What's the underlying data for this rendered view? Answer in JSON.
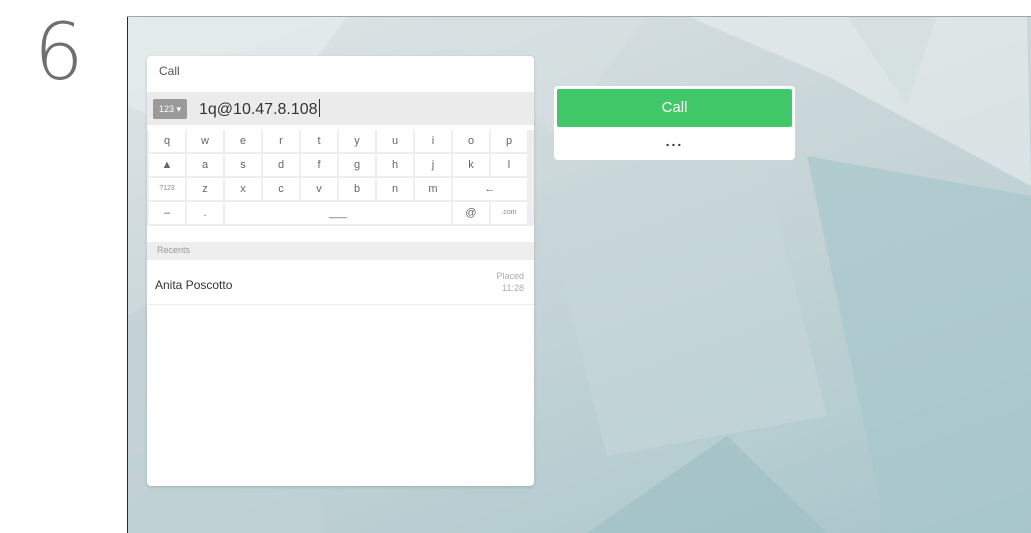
{
  "step_number": "6",
  "dial_panel": {
    "title": "Call",
    "mode_switch": "123 ▾",
    "input_value": "1q@10.47.8.108"
  },
  "keyboard": {
    "row1": [
      "q",
      "w",
      "e",
      "r",
      "t",
      "y",
      "u",
      "i",
      "o",
      "p"
    ],
    "row2": [
      "▲",
      "a",
      "s",
      "d",
      "f",
      "g",
      "h",
      "j",
      "k",
      "l"
    ],
    "row3": [
      "?123",
      "z",
      "x",
      "c",
      "v",
      "b",
      "n",
      "m",
      "←"
    ],
    "row4": [
      "–",
      ".",
      "___",
      "@",
      ".com"
    ]
  },
  "recents": {
    "header": "Recents",
    "items": [
      {
        "name": "Anita Poscotto",
        "status": "Placed",
        "time": "11:28"
      }
    ]
  },
  "actions": {
    "call_label": "Call",
    "more_label": "..."
  },
  "colors": {
    "call_green": "#3fc768",
    "background": "#c3d3d6"
  }
}
